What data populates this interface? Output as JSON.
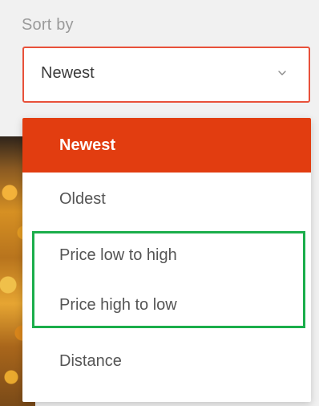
{
  "sort": {
    "label": "Sort by",
    "selected_value": "Newest",
    "chevron_icon": "chevron-down-icon",
    "options": [
      {
        "label": "Newest",
        "selected": true
      },
      {
        "label": "Oldest",
        "selected": false
      },
      {
        "label": "Price low to high",
        "selected": false
      },
      {
        "label": "Price high to low",
        "selected": false
      },
      {
        "label": "Distance",
        "selected": false
      }
    ]
  },
  "colors": {
    "accent": "#e23d10",
    "select_border": "#e8513a",
    "highlight": "#1bae4b"
  }
}
